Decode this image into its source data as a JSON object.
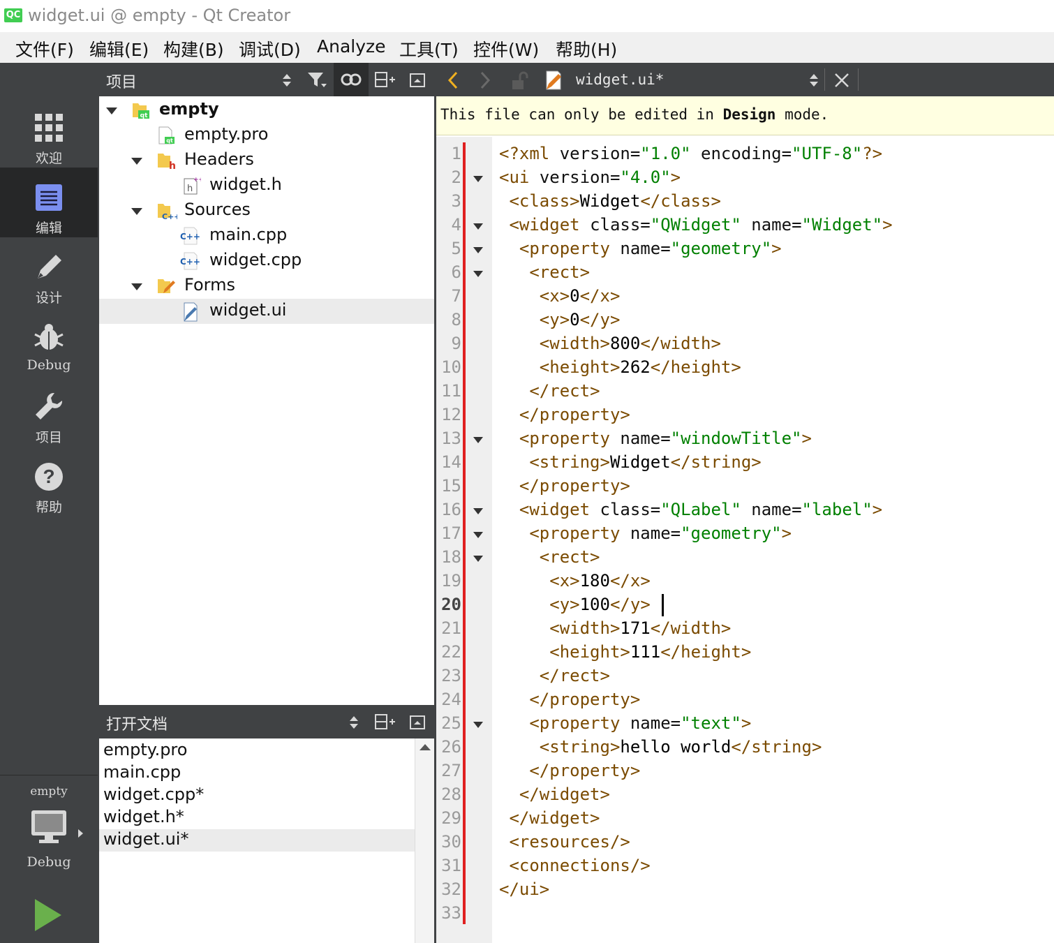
{
  "window": {
    "logo": "QC",
    "title": "widget.ui @ empty - Qt Creator"
  },
  "menubar": {
    "items": [
      "文件(F)",
      "编辑(E)",
      "构建(B)",
      "调试(D)",
      "Analyze",
      "工具(T)",
      "控件(W)",
      "帮助(H)"
    ]
  },
  "modes": [
    {
      "label": "欢迎",
      "icon": "grid-icon"
    },
    {
      "label": "编辑",
      "icon": "document-icon",
      "active": true
    },
    {
      "label": "设计",
      "icon": "pencil-icon"
    },
    {
      "label": "Debug",
      "icon": "bug-icon"
    },
    {
      "label": "项目",
      "icon": "wrench-icon"
    },
    {
      "label": "帮助",
      "icon": "help-icon"
    }
  ],
  "kit": {
    "project": "empty",
    "build": "Debug"
  },
  "project_pane": {
    "title": "项目",
    "tree": [
      {
        "label": "empty",
        "bold": true
      },
      {
        "label": "empty.pro"
      },
      {
        "label": "Headers"
      },
      {
        "label": "widget.h"
      },
      {
        "label": "Sources"
      },
      {
        "label": "main.cpp"
      },
      {
        "label": "widget.cpp"
      },
      {
        "label": "Forms"
      },
      {
        "label": "widget.ui",
        "selected": true
      }
    ]
  },
  "open_docs": {
    "title": "打开文档",
    "items": [
      "empty.pro",
      "main.cpp",
      "widget.cpp*",
      "widget.h*",
      "widget.ui*"
    ],
    "selected_index": 4
  },
  "editor": {
    "file": "widget.ui*",
    "info_prefix": "This file can only be edited in ",
    "info_bold": "Design",
    "info_suffix": " mode.",
    "current_line": 20,
    "line_numbers": [
      "1",
      "2",
      "3",
      "4",
      "5",
      "6",
      "7",
      "8",
      "9",
      "10",
      "11",
      "12",
      "13",
      "14",
      "15",
      "16",
      "17",
      "18",
      "19",
      "20",
      "21",
      "22",
      "23",
      "24",
      "25",
      "26",
      "27",
      "28",
      "29",
      "30",
      "31",
      "32",
      "33"
    ],
    "lines": [
      "<?xml version=\"1.0\" encoding=\"UTF-8\"?>",
      "<ui version=\"4.0\">",
      " <class>Widget</class>",
      " <widget class=\"QWidget\" name=\"Widget\">",
      "  <property name=\"geometry\">",
      "   <rect>",
      "    <x>0</x>",
      "    <y>0</y>",
      "    <width>800</width>",
      "    <height>262</height>",
      "   </rect>",
      "  </property>",
      "  <property name=\"windowTitle\">",
      "   <string>Widget</string>",
      "  </property>",
      "  <widget class=\"QLabel\" name=\"label\">",
      "   <property name=\"geometry\">",
      "    <rect>",
      "     <x>180</x>",
      "     <y>100</y>",
      "     <width>171</width>",
      "     <height>111</height>",
      "    </rect>",
      "   </property>",
      "   <property name=\"text\">",
      "    <string>hello world</string>",
      "   </property>",
      "  </widget>",
      " </widget>",
      " <resources/>",
      " <connections/>",
      "</ui>",
      ""
    ]
  }
}
